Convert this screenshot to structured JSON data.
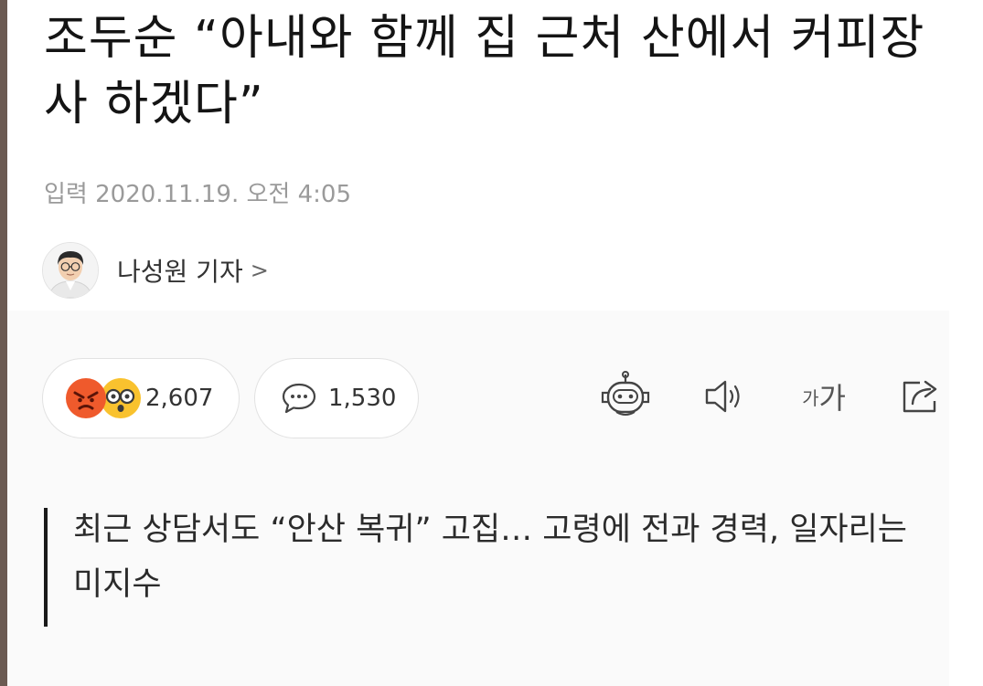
{
  "article": {
    "headline": "조두순 “아내와 함께 집 근처 산에서 커피장사 하겠다”",
    "dateline": "입력 2020.11.19. 오전 4:05",
    "reporter": {
      "name": "나성원 기자",
      "chevron": ">"
    },
    "subheadline": "최근 상담서도 “안산 복귀” 고집… 고령에 전과 경력, 일자리는 미지수"
  },
  "actions": {
    "reaction_count": "2,607",
    "comment_count": "1,530",
    "font_size_small": "가",
    "font_size_large": "가",
    "icons": [
      "angry-emoji-icon",
      "surprised-emoji-icon",
      "comment-bubble-icon",
      "robot-icon",
      "speaker-icon",
      "share-icon"
    ]
  },
  "colors": {
    "angry_emoji": "#ef5a2c",
    "surprised_emoji": "#f9c22e",
    "text_primary": "#141414",
    "text_secondary": "#9a9a9a"
  }
}
